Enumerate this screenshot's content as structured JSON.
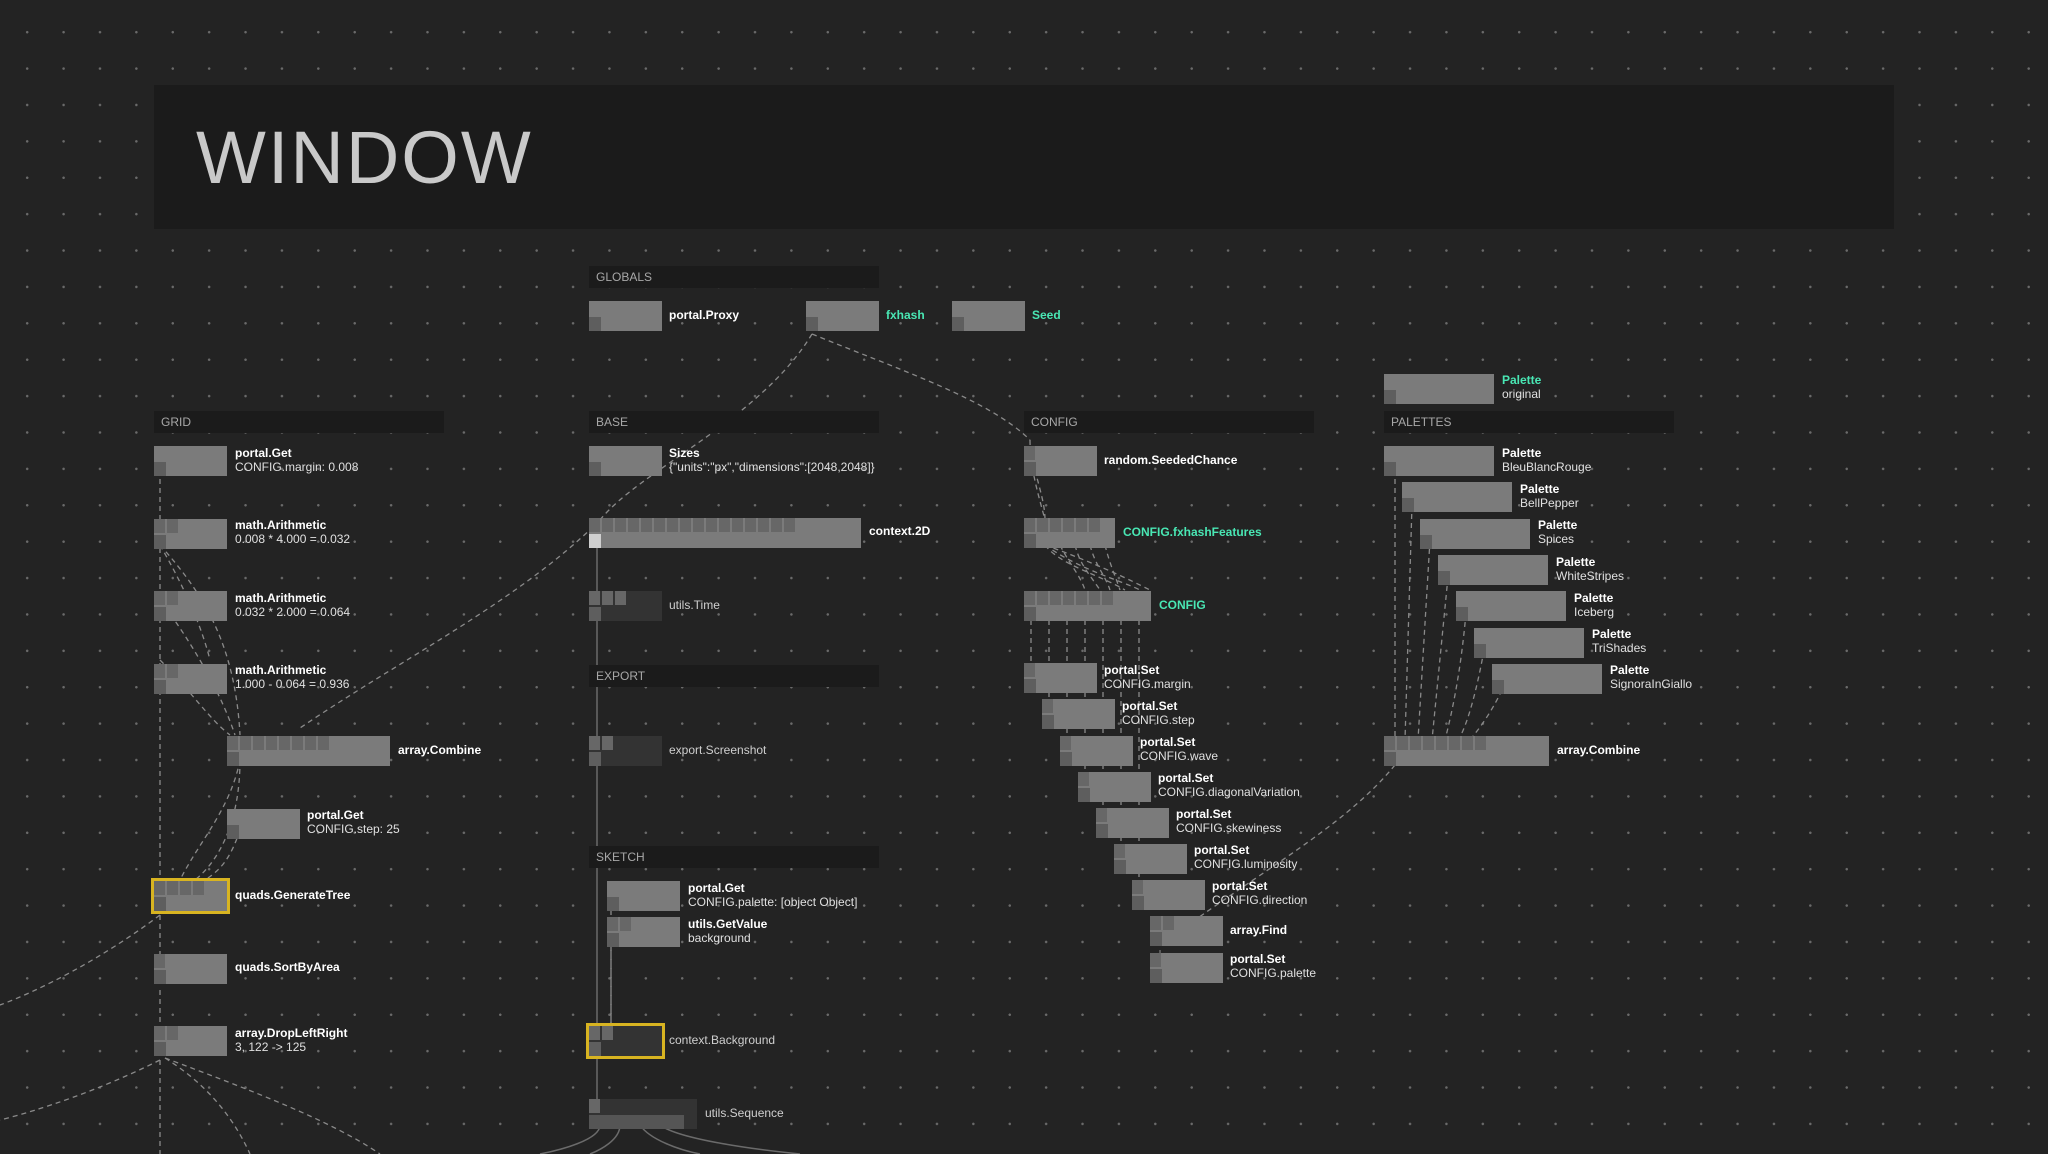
{
  "window_title": "WINDOW",
  "colors": {
    "accent": "#49e7b4",
    "selection": "#d8b421",
    "background": "#232323",
    "group_bar": "#1b1b1b"
  },
  "groups": {
    "globals": "GLOBALS",
    "grid": "GRID",
    "base": "BASE",
    "config": "CONFIG",
    "palettes": "PALETTES",
    "export": "EXPORT",
    "sketch": "SKETCH"
  },
  "nodes": {
    "portal_proxy": {
      "title": "portal.Proxy"
    },
    "fxhash": {
      "title": "fxhash"
    },
    "seed": {
      "title": "Seed"
    },
    "palette_original": {
      "title": "Palette",
      "value": "original"
    },
    "grid_get_margin": {
      "title": "portal.Get",
      "value": "CONFIG.margin: 0.008"
    },
    "grid_arith1": {
      "title": "math.Arithmetic",
      "value": "0.008 * 4.000 = 0.032"
    },
    "grid_arith2": {
      "title": "math.Arithmetic",
      "value": "0.032 * 2.000 = 0.064"
    },
    "grid_arith3": {
      "title": "math.Arithmetic",
      "value": "1.000 - 0.064 = 0.936"
    },
    "grid_combine": {
      "title": "array.Combine"
    },
    "grid_get_step": {
      "title": "portal.Get",
      "value": "CONFIG.step: 25"
    },
    "grid_generate": {
      "title": "quads.GenerateTree"
    },
    "grid_sort": {
      "title": "quads.SortByArea"
    },
    "grid_drop": {
      "title": "array.DropLeftRight",
      "value": "3, 122 -> 125"
    },
    "base_sizes": {
      "title": "Sizes",
      "value": "{\"units\":\"px\",\"dimensions\":[2048,2048]}"
    },
    "base_context": {
      "title": "context.2D"
    },
    "base_time": {
      "title": "utils.Time"
    },
    "export_screenshot": {
      "title": "export.Screenshot"
    },
    "sketch_get_palette": {
      "title": "portal.Get",
      "value": "CONFIG.palette: [object Object]"
    },
    "sketch_getvalue": {
      "title": "utils.GetValue",
      "value": "background"
    },
    "sketch_background": {
      "title": "context.Background"
    },
    "sketch_sequence": {
      "title": "utils.Sequence"
    },
    "config_chance": {
      "title": "random.SeededChance"
    },
    "config_features": {
      "title": "CONFIG.fxhashFeatures"
    },
    "config_config": {
      "title": "CONFIG"
    },
    "config_set_margin": {
      "title": "portal.Set",
      "value": "CONFIG.margin"
    },
    "config_set_step": {
      "title": "portal.Set",
      "value": "CONFIG.step"
    },
    "config_set_wave": {
      "title": "portal.Set",
      "value": "CONFIG.wave"
    },
    "config_set_diag": {
      "title": "portal.Set",
      "value": "CONFIG.diagonalVariation"
    },
    "config_set_skew": {
      "title": "portal.Set",
      "value": "CONFIG.skewiness"
    },
    "config_set_lum": {
      "title": "portal.Set",
      "value": "CONFIG.luminosity"
    },
    "config_set_dir": {
      "title": "portal.Set",
      "value": "CONFIG.direction"
    },
    "config_find": {
      "title": "array.Find"
    },
    "config_set_palette": {
      "title": "portal.Set",
      "value": "CONFIG.palette"
    },
    "pal_bleu": {
      "title": "Palette",
      "value": "BleuBlancRouge"
    },
    "pal_bell": {
      "title": "Palette",
      "value": "BellPepper"
    },
    "pal_spices": {
      "title": "Palette",
      "value": "Spices"
    },
    "pal_white": {
      "title": "Palette",
      "value": "WhiteStripes"
    },
    "pal_ice": {
      "title": "Palette",
      "value": "Iceberg"
    },
    "pal_tri": {
      "title": "Palette",
      "value": "TriShades"
    },
    "pal_signora": {
      "title": "Palette",
      "value": "SignoraInGiallo"
    },
    "pal_combine": {
      "title": "array.Combine"
    }
  }
}
